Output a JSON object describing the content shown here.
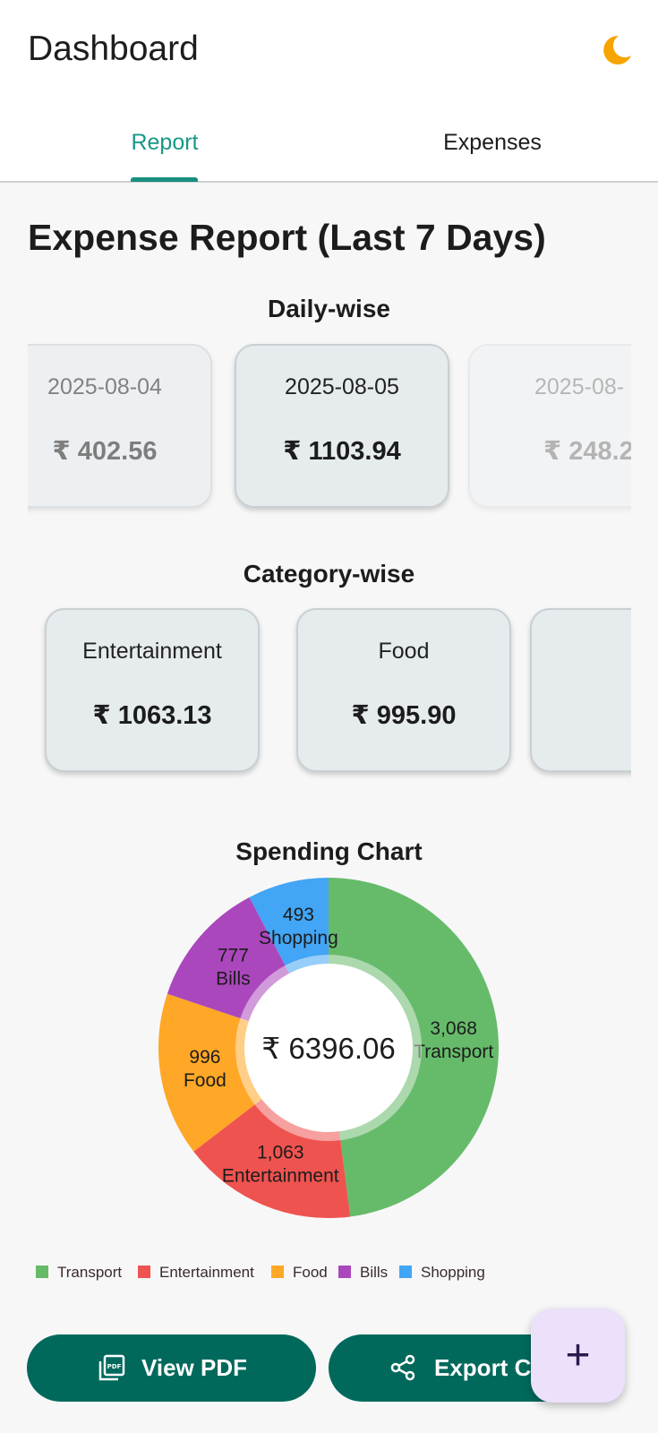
{
  "appbar": {
    "title": "Dashboard",
    "theme_icon": "moon-icon",
    "theme_color": "#f7a400"
  },
  "tabs": [
    {
      "label": "Report",
      "active": true
    },
    {
      "label": "Expenses",
      "active": false
    }
  ],
  "report": {
    "title": "Expense Report (Last 7 Days)",
    "daily_title": "Daily-wise",
    "daily": [
      {
        "date": "2025-08-04",
        "amount": "₹ 402.56"
      },
      {
        "date": "2025-08-05",
        "amount": "₹ 1103.94"
      },
      {
        "date": "2025-08-",
        "amount": "₹ 248.2"
      }
    ],
    "category_title": "Category-wise",
    "categories": [
      {
        "name": "Entertainment",
        "amount": "₹ 1063.13"
      },
      {
        "name": "Food",
        "amount": "₹ 995.90"
      }
    ],
    "chart_title": "Spending Chart"
  },
  "chart_data": {
    "type": "pie",
    "title": "Spending Chart",
    "center_label": "₹ 6396.06",
    "categories": [
      "Transport",
      "Entertainment",
      "Food",
      "Bills",
      "Shopping"
    ],
    "values": [
      3068,
      1063,
      996,
      777,
      493
    ],
    "value_labels": [
      "3,068",
      "1,063",
      "996",
      "777",
      "493"
    ],
    "colors": [
      "#66bb6a",
      "#ef5350",
      "#ffa726",
      "#ab47bc",
      "#42a5f5"
    ],
    "legend": "bottom"
  },
  "actions": {
    "view_pdf": {
      "label": "View PDF",
      "icon": "pdf-icon"
    },
    "export_csv": {
      "label": "Export CSV",
      "icon": "share-icon"
    },
    "fab": {
      "label": "+",
      "icon": "plus-icon"
    }
  }
}
